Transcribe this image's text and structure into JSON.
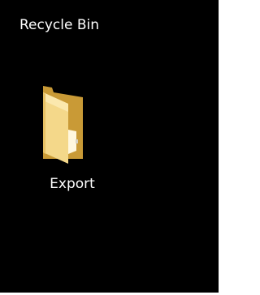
{
  "desktop": {
    "background_color": "#000000",
    "icons": [
      {
        "label": "Recycle Bin",
        "icon": "recycle-bin-icon"
      },
      {
        "label": "Export",
        "icon": "folder-icon"
      }
    ]
  }
}
